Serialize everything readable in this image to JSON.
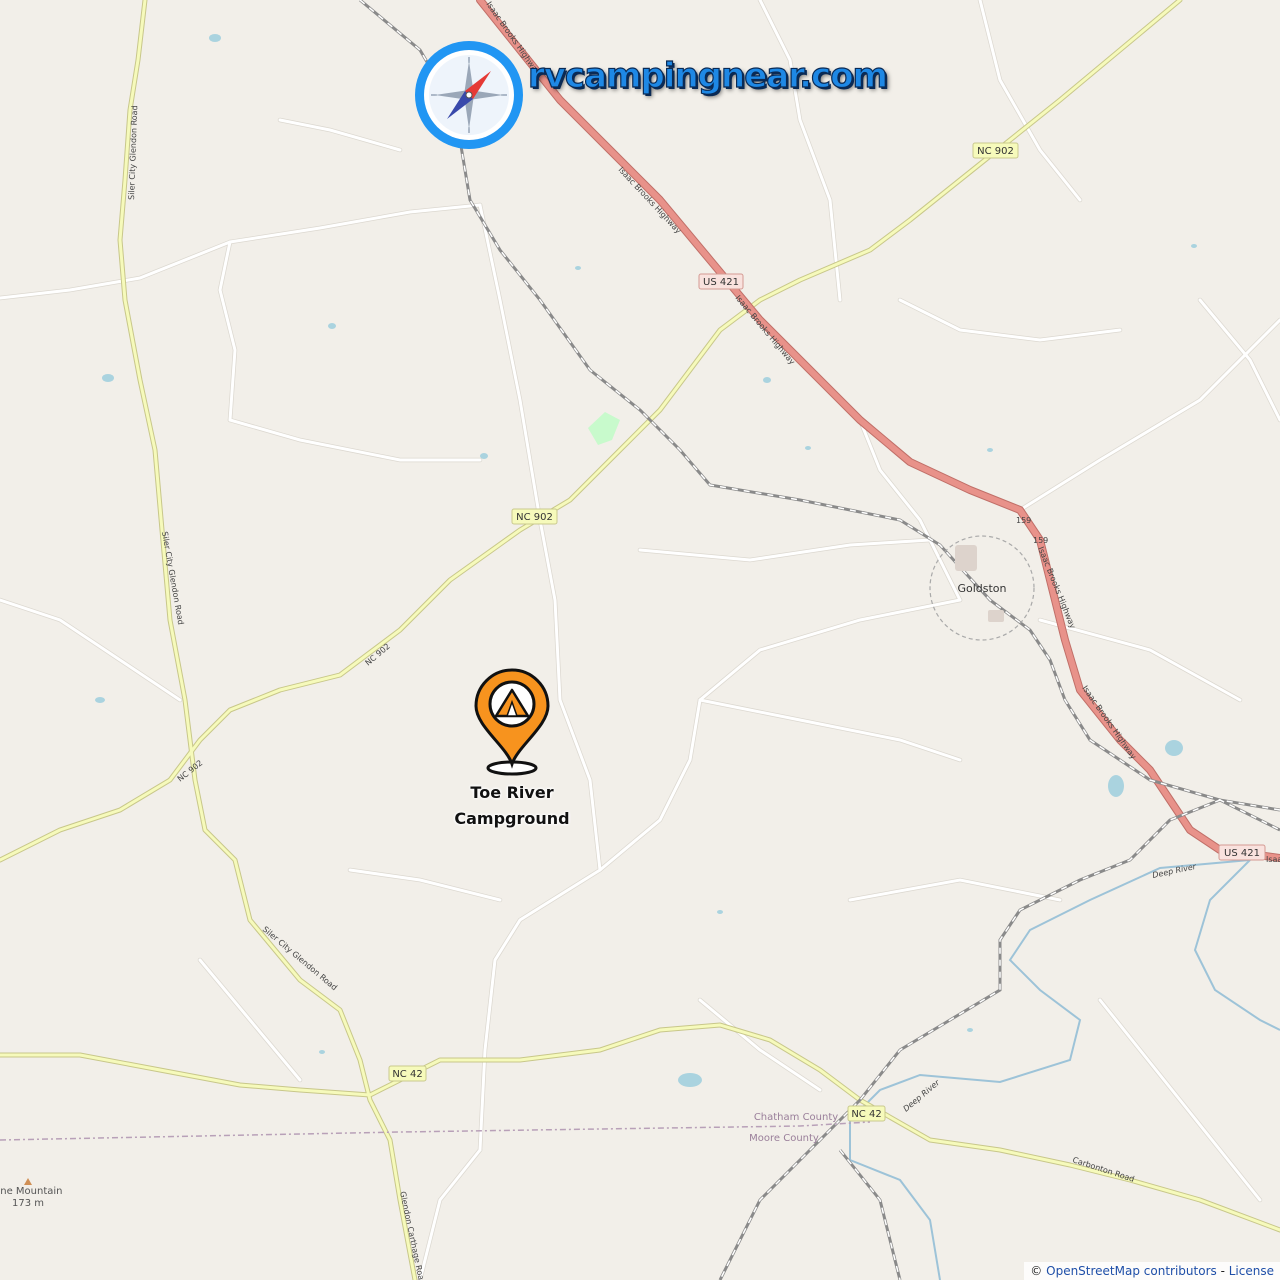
{
  "brand": {
    "site": "rvcampingnear.com",
    "icon": "compass-icon",
    "colors": {
      "ring": "#2196f3",
      "needle_north": "#e53935",
      "needle_south": "#3949ab"
    }
  },
  "marker": {
    "icon": "tent-marker-icon",
    "name_line1": "Toe River",
    "name_line2": "Campground",
    "color": "#f7931e"
  },
  "places": {
    "goldston": "Goldston",
    "mountain_name": "ine Mountain",
    "mountain_elev": "173 m",
    "county_north": "Chatham County",
    "county_south": "Moore County"
  },
  "road_shields": {
    "nc902_a": "NC 902",
    "nc902_b": "NC 902",
    "us421_a": "US 421",
    "us421_b": "US 421",
    "nc42_a": "NC 42",
    "nc42_b": "NC 42",
    "r159_a": "159",
    "r159_b": "159"
  },
  "road_names": {
    "isaac_1": "Isaac Brooks Highway",
    "isaac_2": "Isaac Brooks Highway",
    "isaac_3": "Isaac Brooks Highway",
    "isaac_4": "Isaac Brooks Highway",
    "isaac_5": "Isaac Brooks Highway",
    "isaac_edge": "Isaa",
    "nc902_a": "NC 902",
    "nc902_b": "NC 902",
    "siler_1": "Siler City Glendon Road",
    "siler_2": "Siler City Glendon Road",
    "siler_3": "Siler City Glendon Road",
    "glendon_carthage": "Glendon Carthage Road",
    "carbonton": "Carbonton Road",
    "deep_river_1": "Deep River",
    "deep_river_2": "Deep River"
  },
  "attribution": {
    "copyright": "©",
    "osm": "OpenStreetMap contributors",
    "separator": "-",
    "license": "License"
  },
  "colors": {
    "land": "#f2efe9",
    "primary_road": "#e8928a",
    "secondary_road": "#f6fabb",
    "minor_road": "#ffffff",
    "railway": "#777777",
    "water": "#aad3df",
    "river": "#8db6d3"
  }
}
